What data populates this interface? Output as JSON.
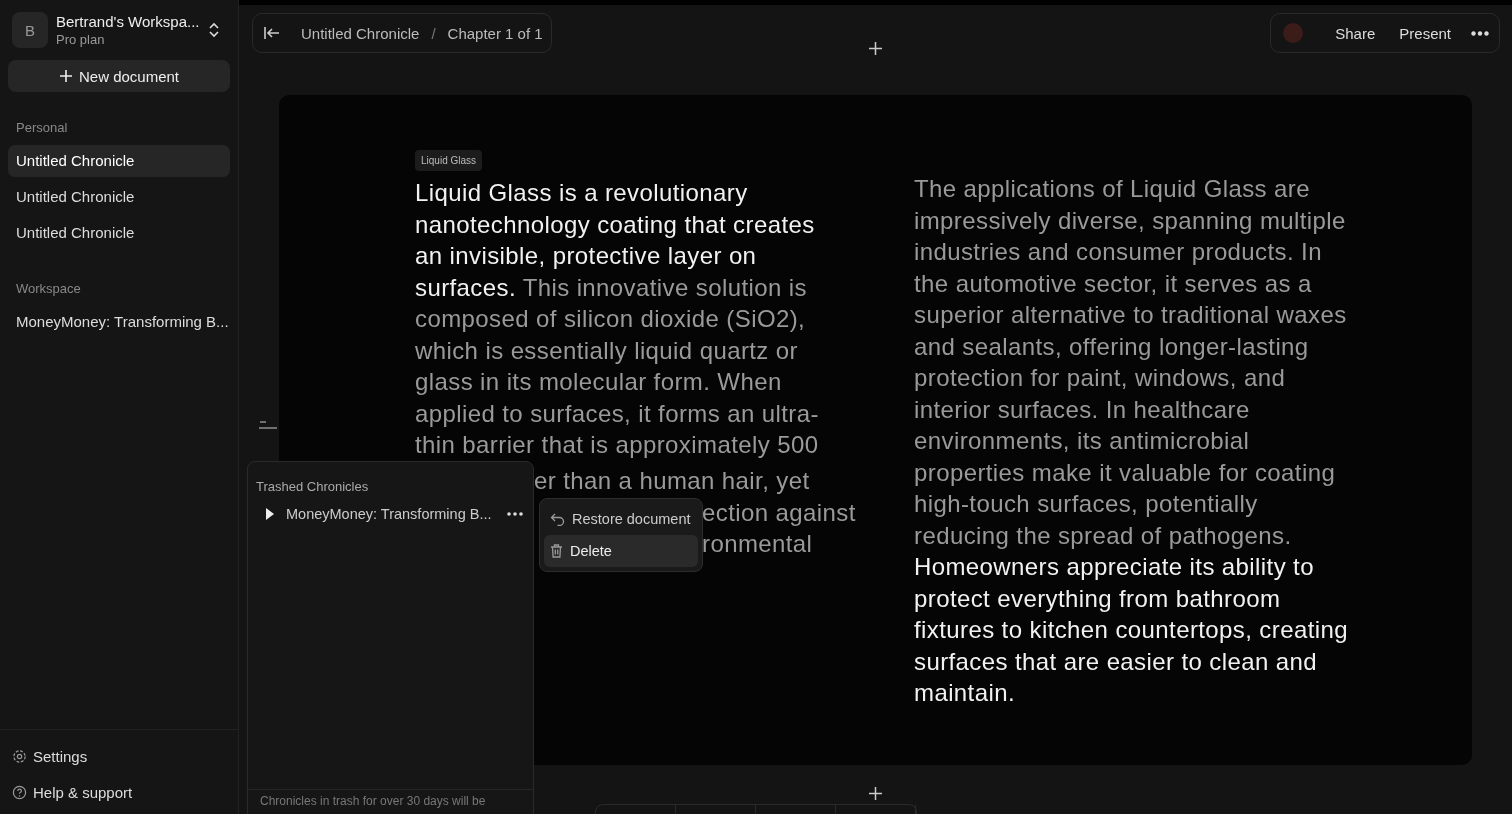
{
  "workspace": {
    "avatar": "B",
    "name": "Bertrand's Workspa...",
    "plan": "Pro plan"
  },
  "new_document": "New document",
  "sections": [
    {
      "title": "Personal",
      "items": [
        {
          "label": "Untitled Chronicle",
          "selected": true
        },
        {
          "label": "Untitled Chronicle",
          "selected": false
        },
        {
          "label": "Untitled Chronicle",
          "selected": false
        }
      ]
    },
    {
      "title": "Workspace",
      "items": [
        {
          "label": "MoneyMoney: Transforming B...",
          "selected": false
        }
      ]
    }
  ],
  "footer_links": [
    {
      "kind": "settings",
      "label": "Settings"
    },
    {
      "kind": "help",
      "label": "Help & support"
    }
  ],
  "breadcrumb": {
    "document": "Untitled Chronicle",
    "separator": "/",
    "chapter": "Chapter 1 of 1"
  },
  "actions": [
    "Share",
    "Present"
  ],
  "document": {
    "tag": "Liquid Glass",
    "left": {
      "lead": "Liquid Glass is a revolutionary nanotechnology coating that creates an invisible, protective layer on surfaces.",
      "body": "This innovative solution is composed of silicon dioxide (SiO2), which is essentially liquid quartz or glass in its molecular form. When applied to surfaces, it forms an ultra-thin barrier that is approximately 500",
      "hidden_fragments": [
        "er than a human hair, yet",
        "ection against",
        "ronmental"
      ]
    },
    "right": {
      "body": "The applications of Liquid Glass are impressively diverse, spanning multiple industries and consumer products. In the automotive sector, it serves as a superior alternative to traditional waxes and sealants, offering longer-lasting protection for paint, windows, and interior surfaces. In healthcare environments, its antimicrobial properties make it valuable for coating high-touch surfaces, potentially reducing the spread of pathogens.",
      "highlight": "Homeowners appreciate its ability to protect everything from bathroom fixtures to kitchen countertops, creating surfaces that are easier to clean and maintain."
    }
  },
  "trash": {
    "title": "Trashed Chronicles",
    "items": [
      {
        "label": "MoneyMoney: Transforming B...",
        "expanded": false
      }
    ],
    "footer": "Chronicles in trash for over 30 days will be"
  },
  "context_menu": [
    {
      "kind": "restore",
      "label": "Restore document",
      "selected": false
    },
    {
      "kind": "delete",
      "label": "Delete",
      "selected": true
    }
  ]
}
